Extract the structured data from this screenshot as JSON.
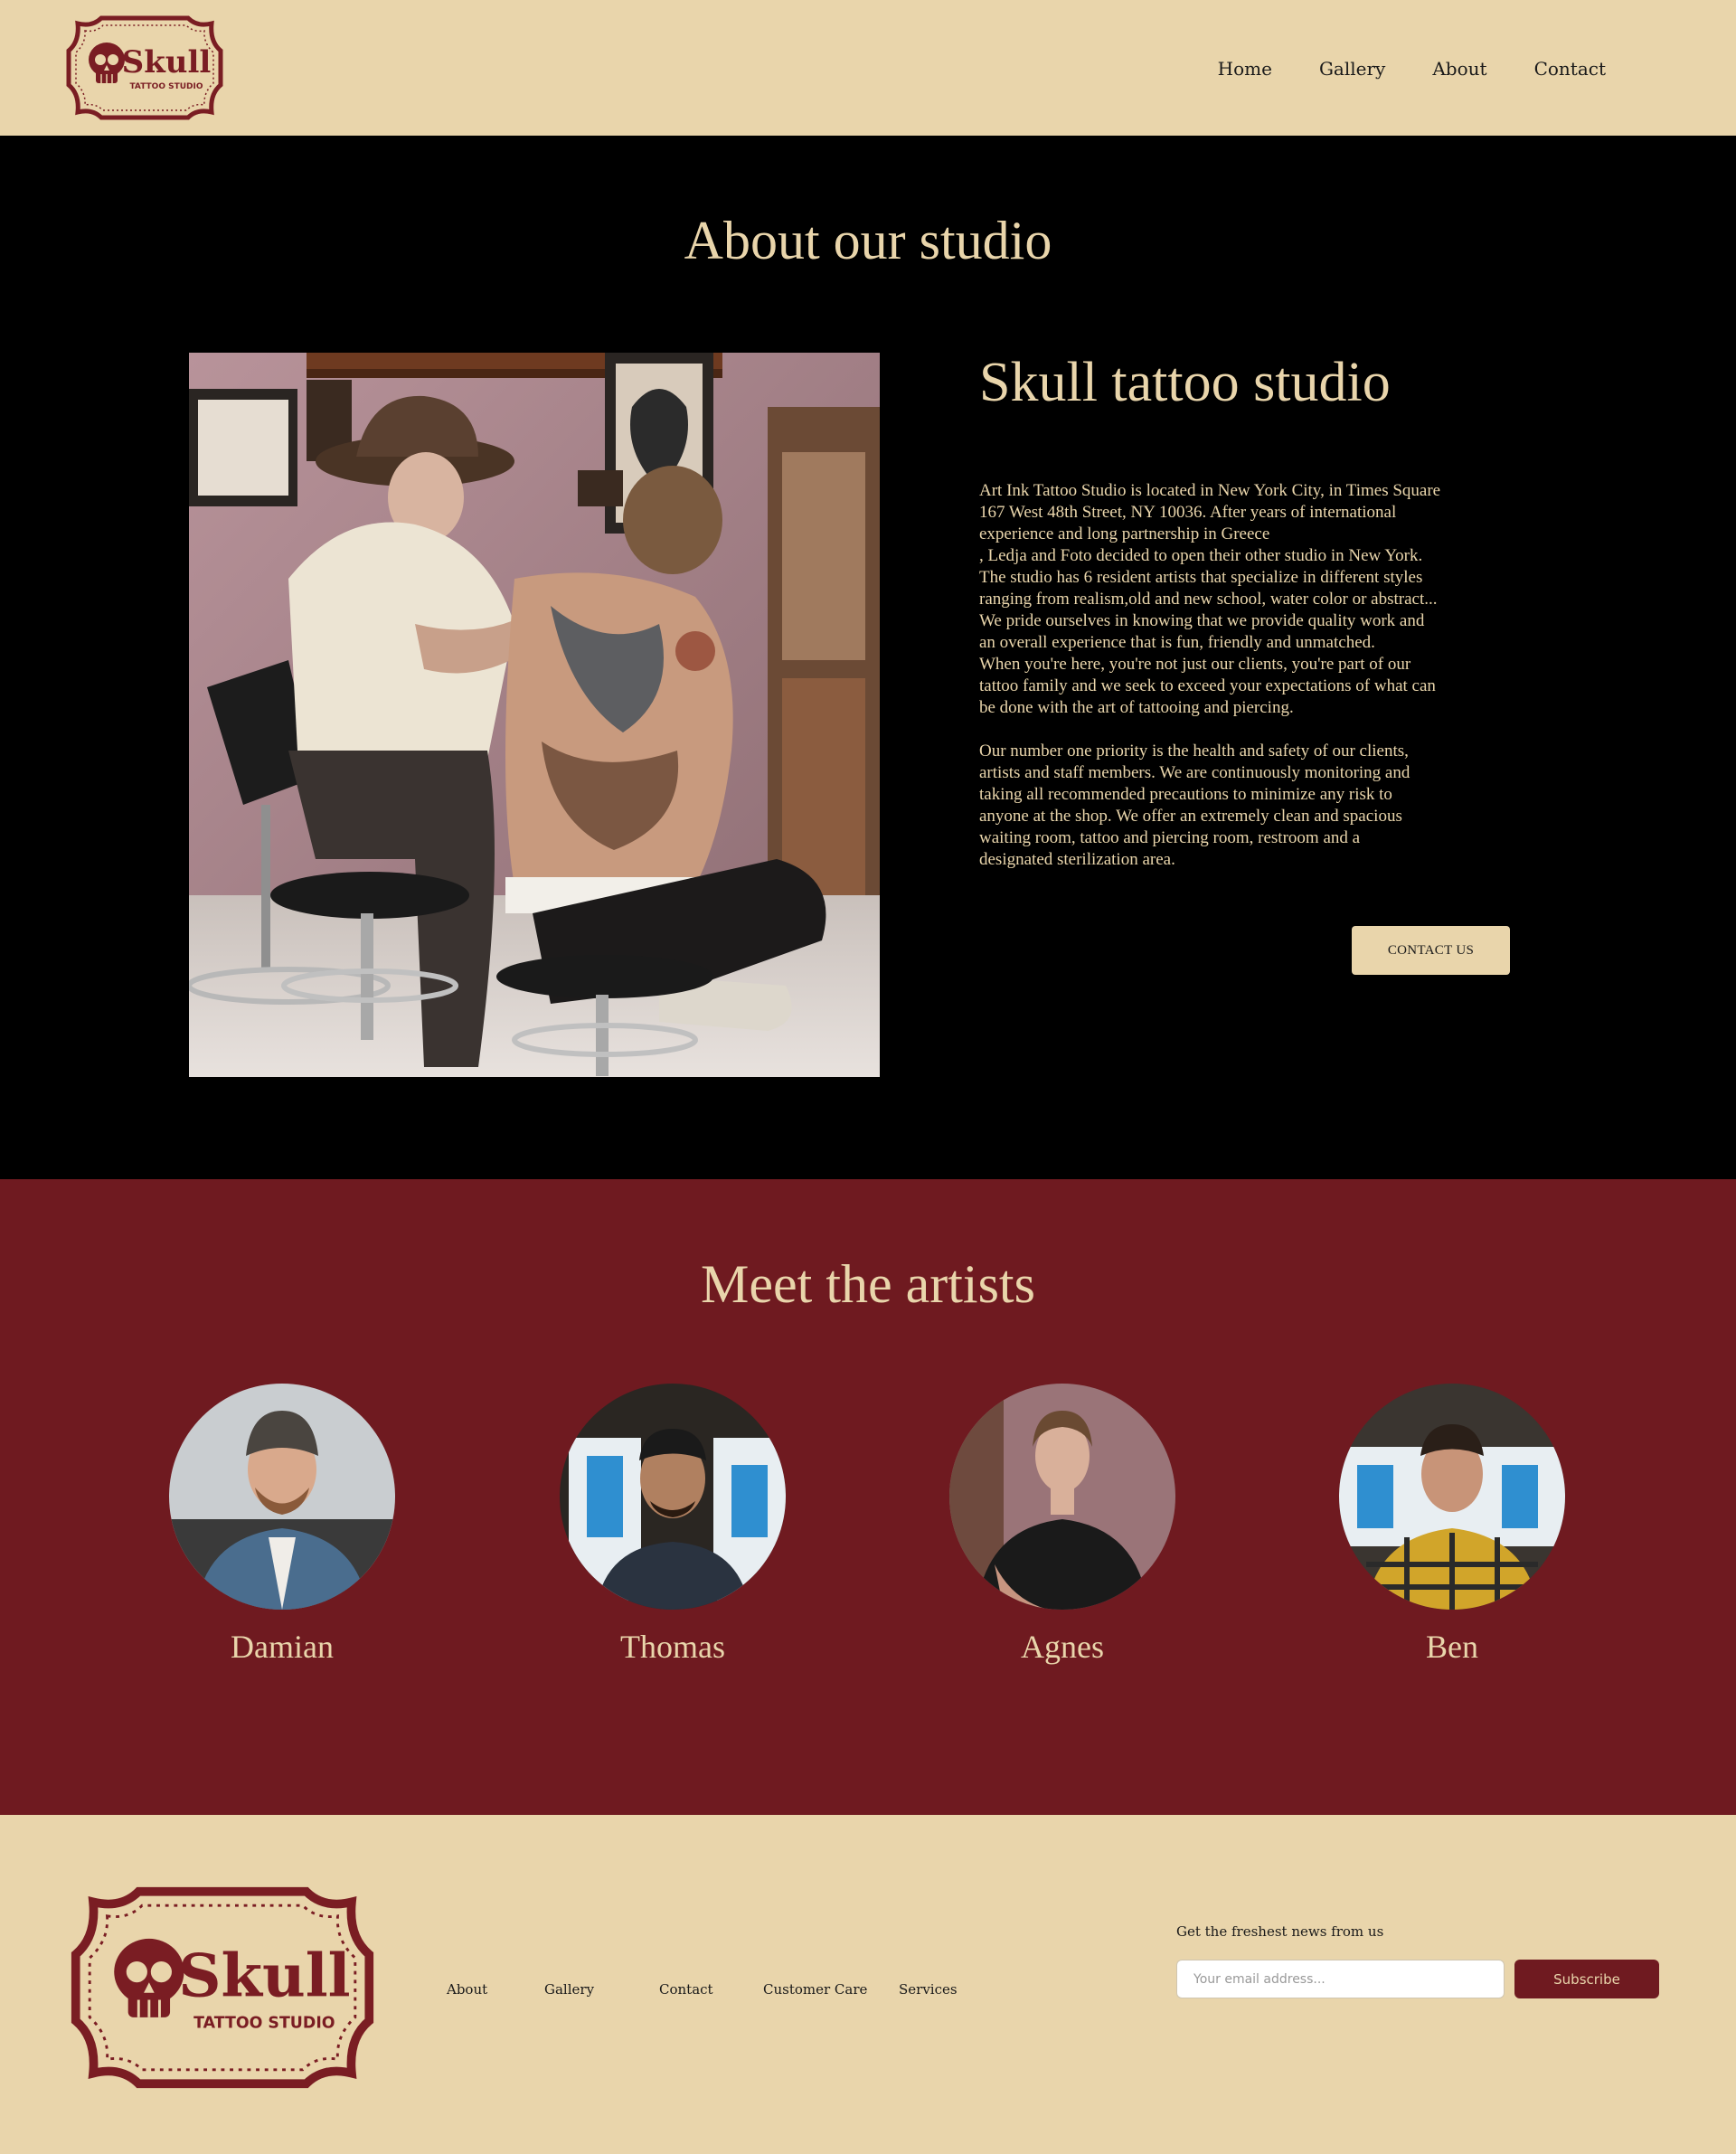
{
  "header": {
    "logo": {
      "word": "Skull",
      "subtitle": "TATTOO STUDIO"
    },
    "nav": [
      "Home",
      "Gallery",
      "About",
      "Contact"
    ]
  },
  "about": {
    "title": "About our studio",
    "photo_icon": "tattoo-session-photo",
    "heading": "Skull tattoo studio",
    "paragraph1": "Art Ink Tattoo Studio is located in New York City, in Times Square\n167 West 48th Street, NY 10036. After years of international\nexperience and long partnership in Greece\n, Ledja and Foto decided to open their other studio in New York.\nThe studio has 6 resident artists that specialize in different styles\nranging from realism,old and new school, water color or abstract...\nWe pride ourselves in knowing that we provide quality work and\nan overall experience that is fun, friendly and unmatched.\nWhen you're here, you're not just our clients, you're part of our\ntattoo family and we seek to exceed your expectations of what can\nbe done with the art of tattooing and piercing.",
    "paragraph2": "Our number one priority is the health and safety of our clients,\nartists and staff members. We are continuously monitoring and\ntaking all recommended precautions to minimize any risk to\nanyone at the shop. We offer an extremely clean and spacious\nwaiting room, tattoo and piercing room, restroom and a\ndesignated sterilization area.",
    "cta": "CONTACT US"
  },
  "artists": {
    "title": "Meet the artists",
    "items": [
      {
        "name": "Damian"
      },
      {
        "name": "Thomas"
      },
      {
        "name": "Agnes"
      },
      {
        "name": "Ben"
      }
    ]
  },
  "footer": {
    "logo": {
      "word": "Skull",
      "subtitle": "TATTOO STUDIO"
    },
    "links": [
      "About",
      "Gallery",
      "Contact",
      "Customer Care",
      "Services"
    ],
    "newsletter_label": "Get the freshest news from us",
    "email_placeholder": "Your email address...",
    "subscribe_label": "Subscribe"
  },
  "colors": {
    "cream": "#E9D5AB",
    "maroon": "#6F1A20",
    "black": "#000000"
  }
}
